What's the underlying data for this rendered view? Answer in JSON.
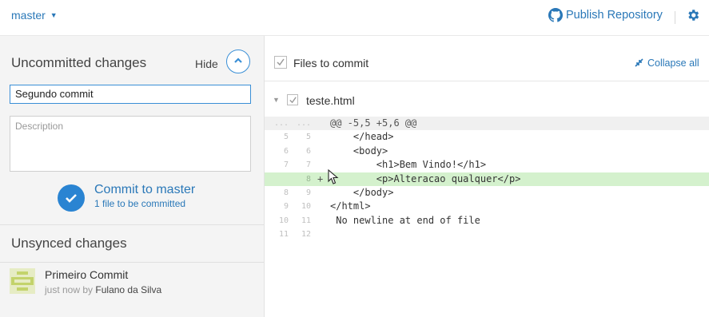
{
  "topbar": {
    "branch": "master",
    "publish_label": "Publish Repository",
    "icons": {
      "branch_caret": "caret-down-icon",
      "publish": "github-octocat-icon",
      "settings": "gear-icon"
    },
    "accent_color": "#2a78b8"
  },
  "uncommitted": {
    "title": "Uncommitted changes",
    "hide_label": "Hide",
    "summary_value": "Segundo commit",
    "description_placeholder": "Description",
    "commit_button_label": "Commit to master",
    "commit_sub": "1 file to be committed"
  },
  "unsynced": {
    "title": "Unsynced changes",
    "commits": [
      {
        "title": "Primeiro Commit",
        "time": "just now",
        "by": "by",
        "author": "Fulano da Silva"
      }
    ]
  },
  "files": {
    "header_label": "Files to commit",
    "collapse_label": "Collapse all",
    "file_name": "teste.html"
  },
  "diff": {
    "lines": [
      {
        "old": "...",
        "new": "...",
        "sign": "",
        "code": "@@ -5,5 +5,6 @@",
        "type": "hunk"
      },
      {
        "old": "5",
        "new": "5",
        "sign": "",
        "code": "    </head>",
        "type": "ctx"
      },
      {
        "old": "6",
        "new": "6",
        "sign": "",
        "code": "    <body>",
        "type": "ctx"
      },
      {
        "old": "7",
        "new": "7",
        "sign": "",
        "code": "        <h1>Bem Vindo!</h1>",
        "type": "ctx"
      },
      {
        "old": "",
        "new": "8",
        "sign": "+",
        "code": "        <p>Alteracao qualquer</p>",
        "type": "add"
      },
      {
        "old": "8",
        "new": "9",
        "sign": "",
        "code": "    </body>",
        "type": "ctx"
      },
      {
        "old": "9",
        "new": "10",
        "sign": "",
        "code": "</html>",
        "type": "ctx"
      },
      {
        "old": "10",
        "new": "11",
        "sign": "",
        "code": " No newline at end of file",
        "type": "ctx"
      },
      {
        "old": "11",
        "new": "12",
        "sign": "",
        "code": "",
        "type": "ctx"
      }
    ]
  }
}
